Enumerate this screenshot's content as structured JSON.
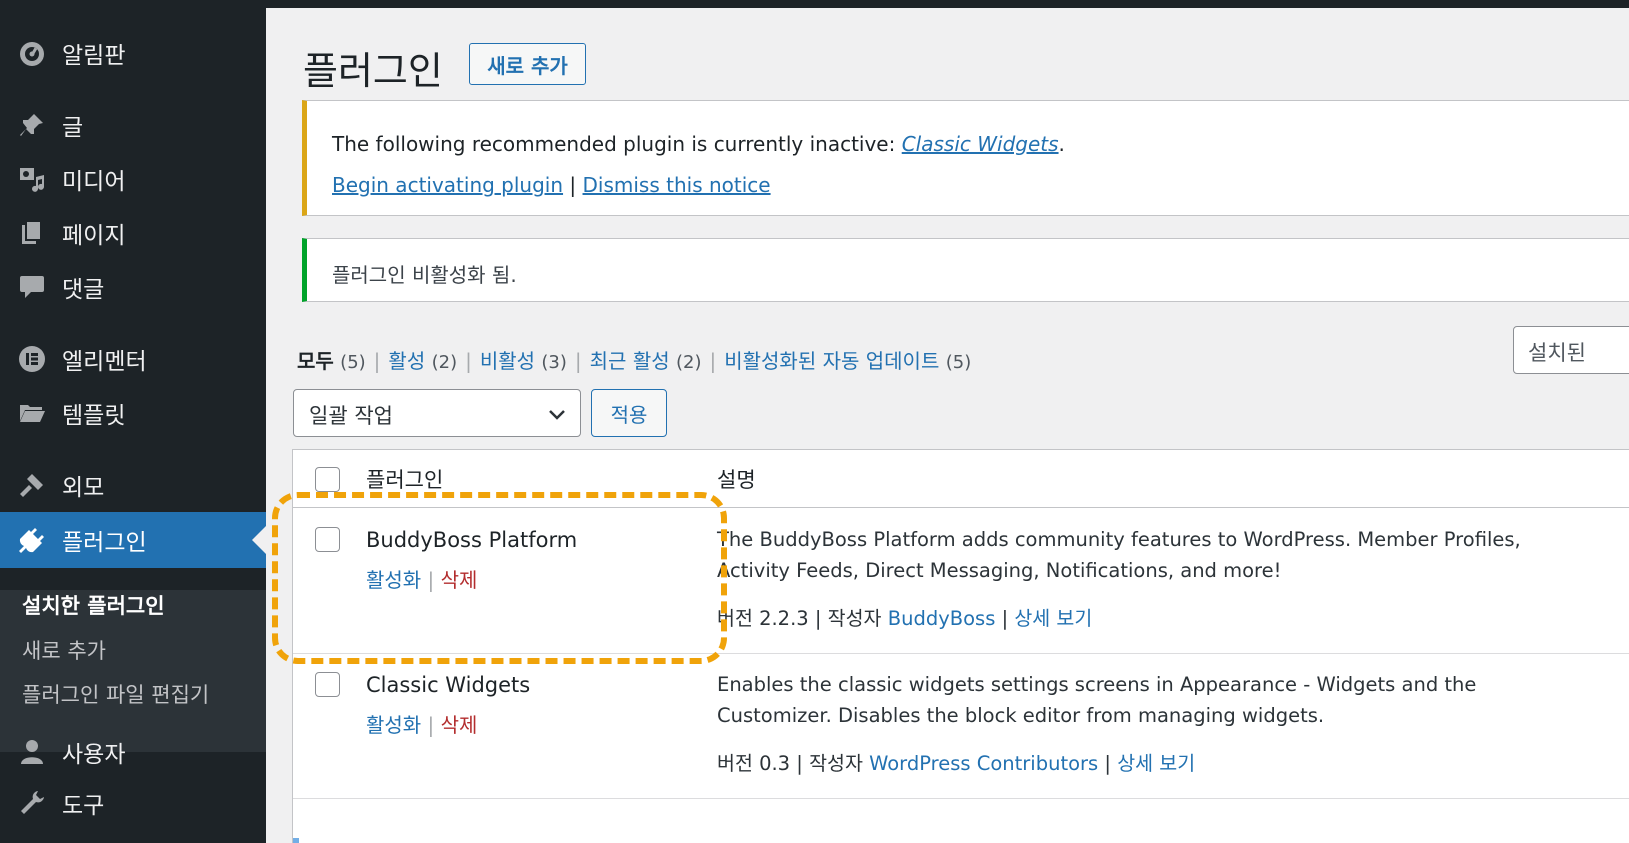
{
  "sidebar": {
    "items": [
      {
        "label": "알림판",
        "icon": "dashboard-icon"
      },
      {
        "label": "글",
        "icon": "pin-icon"
      },
      {
        "label": "미디어",
        "icon": "media-icon"
      },
      {
        "label": "페이지",
        "icon": "pages-icon"
      },
      {
        "label": "댓글",
        "icon": "comment-icon"
      },
      {
        "label": "엘리멘터",
        "icon": "elementor-icon"
      },
      {
        "label": "템플릿",
        "icon": "folder-icon"
      },
      {
        "label": "외모",
        "icon": "brush-icon"
      },
      {
        "label": "플러그인",
        "icon": "plugin-icon"
      },
      {
        "label": "사용자",
        "icon": "user-icon"
      },
      {
        "label": "도구",
        "icon": "tools-icon"
      }
    ],
    "submenu": [
      "설치한 플러그인",
      "새로 추가",
      "플러그인 파일 편집기"
    ]
  },
  "header": {
    "title": "플러그인",
    "add_new": "새로 추가"
  },
  "notices": {
    "warn_text": "The following recommended plugin is currently inactive: ",
    "warn_link": "Classic Widgets",
    "warn_period": ".",
    "begin_link": "Begin activating plugin",
    "divider": "|",
    "dismiss_link": "Dismiss this notice",
    "ok_text": "플러그인 비활성화 됨."
  },
  "filters": {
    "all": "모두",
    "all_count": "(5)",
    "active": "활성",
    "active_count": "(2)",
    "inactive": "비활성",
    "inactive_count": "(3)",
    "recent": "최근 활성",
    "recent_count": "(2)",
    "autoupdate": "비활성화된 자동 업데이트",
    "autoupdate_count": "(5)",
    "sep": "|"
  },
  "search_btn": "설치된",
  "bulk": {
    "selected": "일괄 작업",
    "apply": "적용"
  },
  "table": {
    "col_plugin": "플러그인",
    "col_desc": "설명",
    "rows": [
      {
        "name": "BuddyBoss Platform",
        "activate": "활성화",
        "delete": "삭제",
        "desc": "The BuddyBoss Platform adds community features to WordPress. Member Profiles, Activity Feeds, Direct Messaging, Notifications, and more!",
        "version": "버전 2.2.3",
        "by": "작성자",
        "author": "BuddyBoss",
        "details": "상세 보기"
      },
      {
        "name": "Classic Widgets",
        "activate": "활성화",
        "delete": "삭제",
        "desc": "Enables the classic widgets settings screens in Appearance - Widgets and the Customizer. Disables the block editor from managing widgets.",
        "version": "버전 0.3",
        "by": "작성자",
        "author": "WordPress Contributors",
        "details": "상세 보기"
      }
    ]
  },
  "colors": {
    "sidebar_bg": "#1d2327",
    "active_blue": "#2271b1",
    "warn_border": "#dba617",
    "ok_border": "#00a32a",
    "highlight": "#f0a30a",
    "delete_red": "#b32d2e"
  }
}
